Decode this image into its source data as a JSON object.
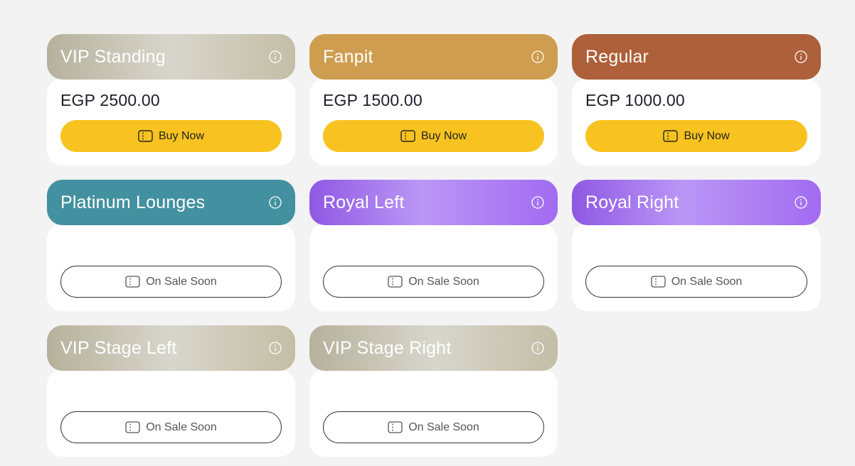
{
  "colors": {
    "buy_button": "#f8c320",
    "page_bg": "#f3f3f3",
    "fanpit": "#cf9d4f",
    "regular": "#ad6039",
    "platinum": "#4391a0"
  },
  "cards": [
    {
      "title": "VIP Standing",
      "price": "EGP 2500.00",
      "button": "Buy Now",
      "status": "buy"
    },
    {
      "title": "Fanpit",
      "price": "EGP 1500.00",
      "button": "Buy Now",
      "status": "buy"
    },
    {
      "title": "Regular",
      "price": "EGP 1000.00",
      "button": "Buy Now",
      "status": "buy"
    },
    {
      "title": "Platinum Lounges",
      "price": "",
      "button": "On Sale Soon",
      "status": "soon"
    },
    {
      "title": "Royal Left",
      "price": "",
      "button": "On Sale Soon",
      "status": "soon"
    },
    {
      "title": "Royal Right",
      "price": "",
      "button": "On Sale Soon",
      "status": "soon"
    },
    {
      "title": "VIP Stage Left",
      "price": "",
      "button": "On Sale Soon",
      "status": "soon"
    },
    {
      "title": "VIP Stage Right",
      "price": "",
      "button": "On Sale Soon",
      "status": "soon"
    }
  ],
  "icons": {
    "header": "info-icon",
    "button": "ticket-icon"
  }
}
